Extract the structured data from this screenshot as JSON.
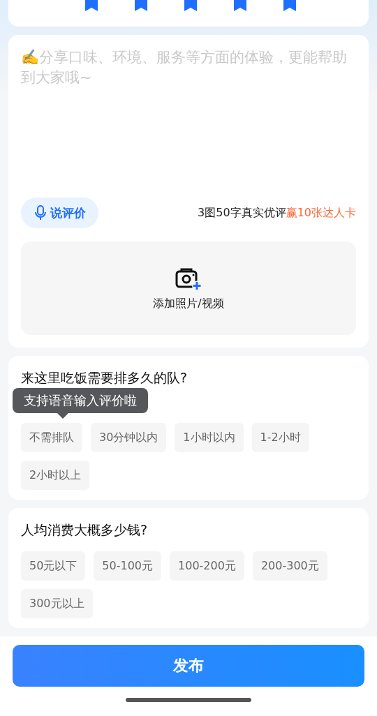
{
  "rating_card": {
    "stars": 5
  },
  "review": {
    "placeholder": "✍️分享口味、环境、服务等方面的体验，更能帮助到大家哦~",
    "voice_button": "说评价",
    "reward_note": "3图50字真实优评",
    "reward_highlight": "赢10张达人卡",
    "upload_label": "添加照片/视频"
  },
  "questions": [
    {
      "title": "来这里吃饭需要排多久的队?",
      "options": [
        {
          "label": "不需排队",
          "selected": false
        },
        {
          "label": "30分钟以内",
          "selected": false
        },
        {
          "label": "1小时以内",
          "selected": false
        },
        {
          "label": "1-2小时",
          "selected": false
        },
        {
          "label": "2小时以上",
          "selected": false
        }
      ]
    },
    {
      "title": "人均消费大概多少钱?",
      "options": [
        {
          "label": "50元以下",
          "selected": false
        },
        {
          "label": "50-100元",
          "selected": false
        },
        {
          "label": "100-200元",
          "selected": false
        },
        {
          "label": "200-300元",
          "selected": false
        },
        {
          "label": "300元以上",
          "selected": false
        }
      ]
    }
  ],
  "tooltip": "支持语音输入评价啦",
  "submit_button": "发布"
}
